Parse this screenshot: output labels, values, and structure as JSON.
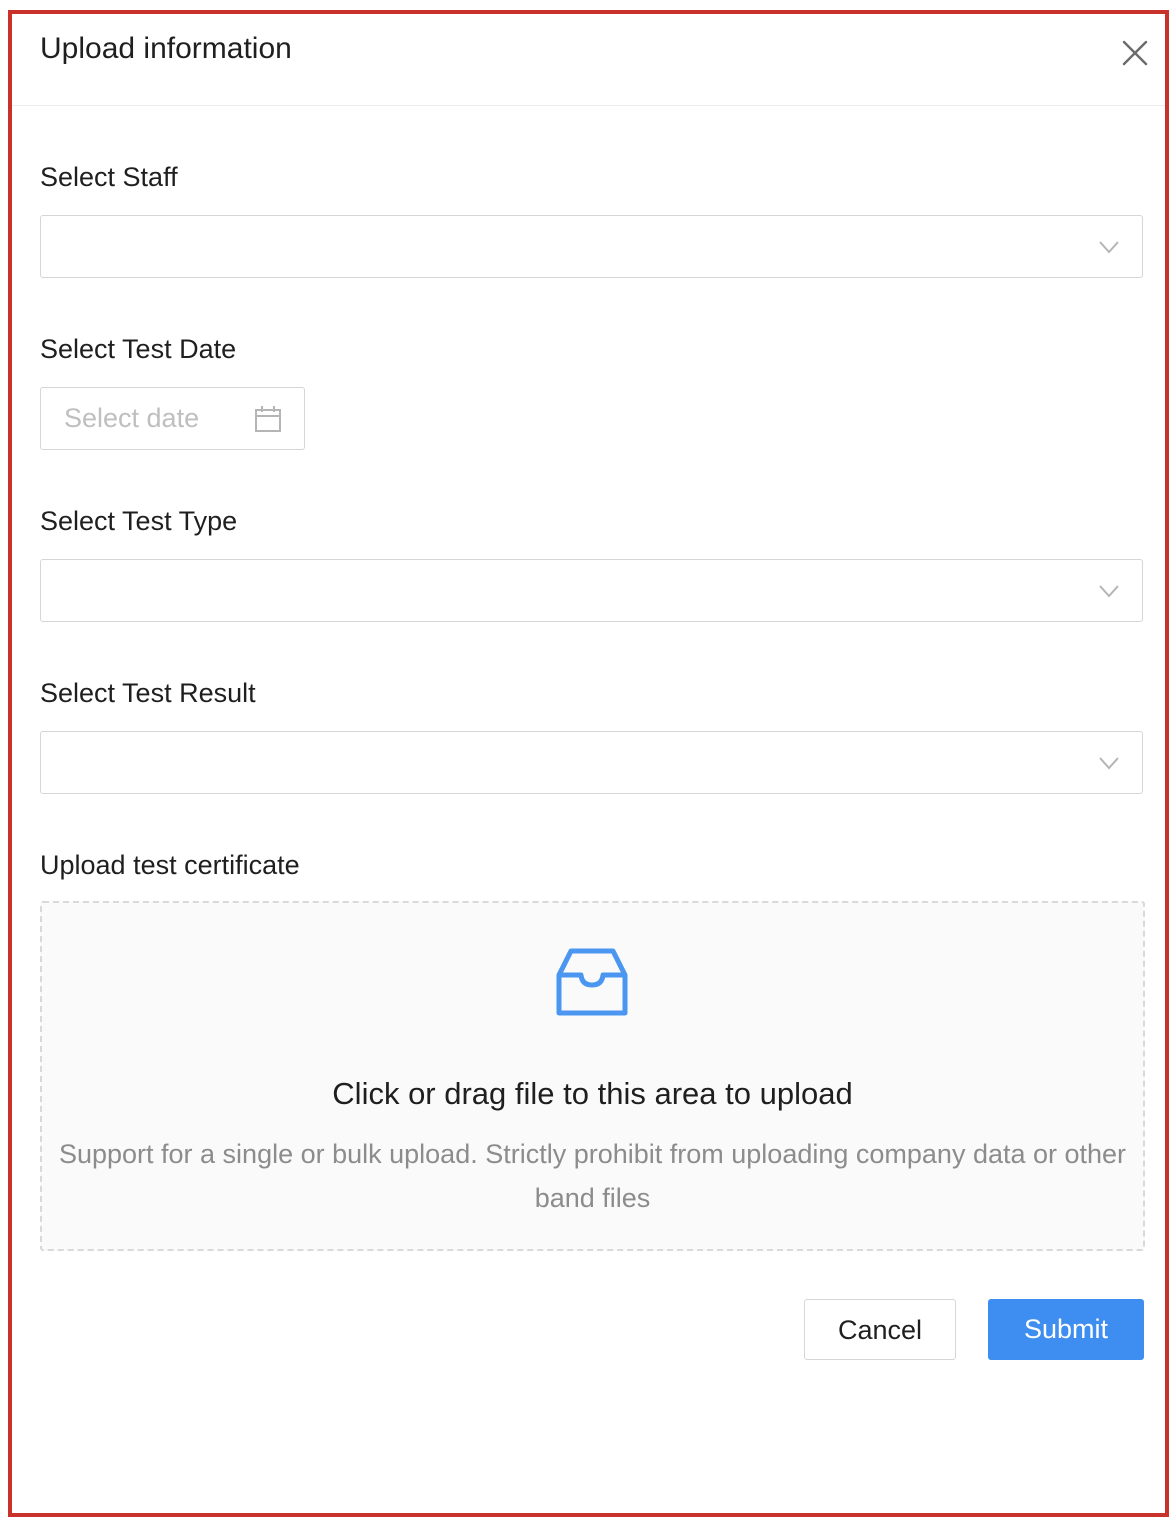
{
  "modal": {
    "title": "Upload information",
    "close_icon": "close-icon"
  },
  "form": {
    "staff_label": "Select Staff",
    "staff_value": "",
    "test_date_label": "Select Test Date",
    "test_date_placeholder": "Select date",
    "test_type_label": "Select Test Type",
    "test_type_value": "",
    "test_result_label": "Select Test Result",
    "test_result_value": "",
    "upload_label": "Upload test certificate"
  },
  "upload": {
    "icon": "inbox-icon",
    "main_text": "Click or drag file to this area to upload",
    "hint_text": "Support for a single or bulk upload. Strictly prohibit from uploading company data or other band files"
  },
  "actions": {
    "cancel_label": "Cancel",
    "submit_label": "Submit"
  },
  "colors": {
    "frame_border": "#c8322b",
    "primary": "#3d8ef0",
    "upload_icon": "#3d8ef0"
  }
}
